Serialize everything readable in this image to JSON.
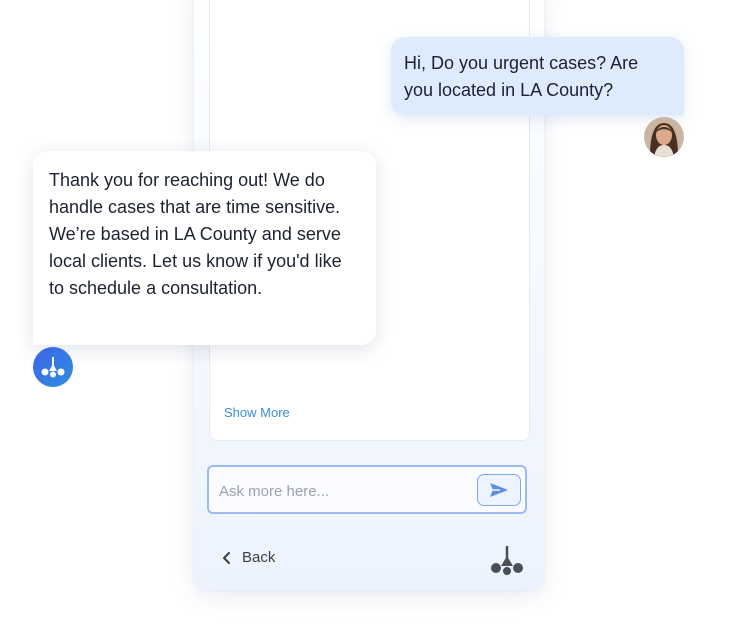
{
  "chat": {
    "user_message": "Hi, Do you urgent cases? Are you located in LA County?",
    "bot_message": "Thank you for reaching out! We do handle cases that are time sensitive. We’re based in LA County and serve local clients. Let us know if you'd like to schedule a consultation."
  },
  "widget": {
    "show_more_label": "Show More",
    "input_placeholder": "Ask more here...",
    "input_value": "",
    "back_label": "Back"
  },
  "icons": {
    "send": "send-icon",
    "back": "chevron-left-icon",
    "brand": "brand-logo-icon"
  },
  "colors": {
    "user_bubble": "#deebfd",
    "bot_avatar": "#3d63e6",
    "link": "#3d8fd8",
    "input_border": "#9cbcef"
  }
}
